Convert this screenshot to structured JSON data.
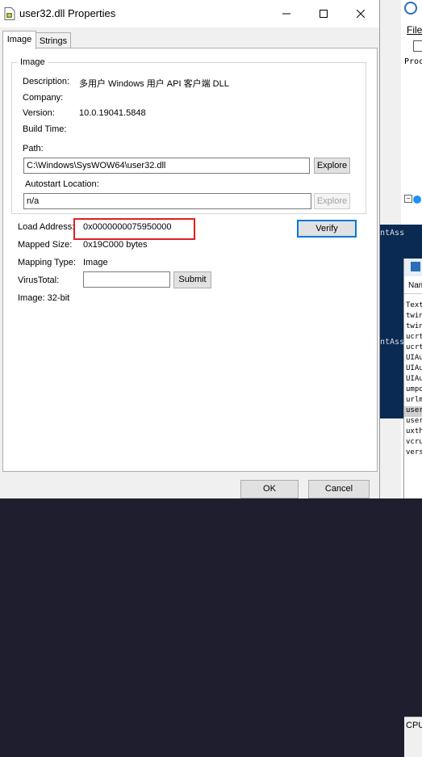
{
  "window": {
    "title": "user32.dll Properties",
    "controls": [
      "minimize",
      "maximize",
      "close"
    ]
  },
  "tabs": [
    {
      "label": "Image",
      "active": true
    },
    {
      "label": "Strings",
      "active": false
    }
  ],
  "image_group": {
    "title": "Image",
    "description_label": "Description:",
    "description_value": "多用户 Windows 用户 API 客户端 DLL",
    "company_label": "Company:",
    "company_value": "",
    "version_label": "Version:",
    "version_value": "10.0.19041.5848",
    "build_time_label": "Build Time:",
    "build_time_value": "",
    "path_label": "Path:",
    "path_value": "C:\\Windows\\SysWOW64\\user32.dll",
    "explore_label": "Explore",
    "autostart_label": "Autostart Location:",
    "autostart_value": "n/a",
    "explore_disabled_label": "Explore"
  },
  "details": {
    "load_address_label": "Load Address:",
    "load_address_value": "0x0000000075950000",
    "verify_label": "Verify",
    "mapped_size_label": "Mapped Size:",
    "mapped_size_value": "0x19C000 bytes",
    "mapping_type_label": "Mapping Type:",
    "mapping_type_value": "Image",
    "virustotal_label": "VirusTotal:",
    "virustotal_value": "",
    "submit_label": "Submit",
    "image_bits": "Image: 32-bit"
  },
  "footer": {
    "ok_label": "OK",
    "cancel_label": "Cancel"
  },
  "background": {
    "file_menu": "File",
    "proc_text": "Proc",
    "dark_text_1": "ntAss",
    "dark_text_2": "ntAss",
    "list_header": "Nam",
    "rows": [
      "Text",
      "twin",
      "twin",
      "ucrt",
      "ucrt",
      "UIAu",
      "UIAu",
      "UIAu",
      "umpo",
      "urlm",
      "user",
      "user",
      "uxth",
      "vcru",
      "vers"
    ],
    "selected_row_index": 10,
    "cpu_label": "CPU"
  },
  "colors": {
    "highlight": "#e02020",
    "accent": "#0078d7",
    "dark_panel": "#0a2a54"
  }
}
